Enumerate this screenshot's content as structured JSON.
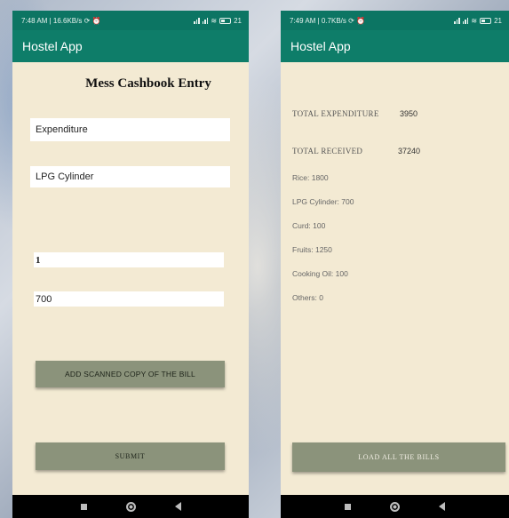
{
  "left": {
    "status": {
      "time_text": "7:48 AM | 16.6KB/s",
      "battery": "21"
    },
    "app_title": "Hostel App",
    "form_title": "Mess Cashbook Entry",
    "entry_type": "Expenditure",
    "item": "LPG Cylinder",
    "quantity": "1",
    "amount": "700",
    "scan_button": "ADD SCANNED COPY OF THE BILL",
    "submit_button": "SUBMIT"
  },
  "right": {
    "status": {
      "time_text": "7:49 AM | 0.7KB/s",
      "battery": "21"
    },
    "app_title": "Hostel App",
    "total_expenditure_label": "TOTAL EXPENDITURE",
    "total_expenditure_value": "3950",
    "total_received_label": "TOTAL RECEIVED",
    "total_received_value": "37240",
    "breakdown": [
      "Rice: 1800",
      "LPG Cylinder: 700",
      "Curd: 100",
      "Fruits: 1250",
      "Cooking Oil: 100",
      "Others: 0"
    ],
    "load_button": "LOAD ALL THE BILLS"
  },
  "icons": [
    "sync-icon",
    "alarm-icon",
    "signal-icon",
    "wifi-icon",
    "battery-icon",
    "recents-icon",
    "home-icon",
    "back-icon"
  ],
  "colors": {
    "appbar": "#0e7d69",
    "background": "#f3ead3",
    "button": "#8b937b"
  }
}
